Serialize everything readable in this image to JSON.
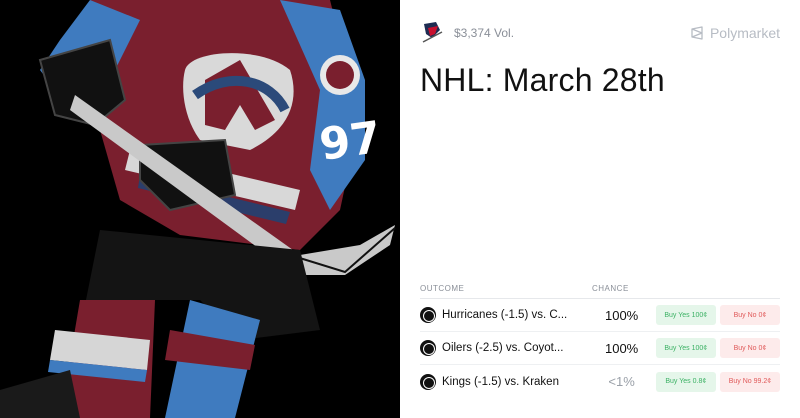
{
  "header": {
    "volume": "$3,374 Vol.",
    "brand": "Polymarket"
  },
  "market": {
    "title": "NHL: March 28th"
  },
  "table": {
    "col_outcome": "OUTCOME",
    "col_chance": "CHANCE",
    "rows": [
      {
        "outcome": "Hurricanes (-1.5) vs. C...",
        "chance": "100%",
        "buy_yes": "Buy Yes 100¢",
        "buy_no": "Buy No 0¢"
      },
      {
        "outcome": "Oilers (-2.5) vs. Coyot...",
        "chance": "100%",
        "buy_yes": "Buy Yes 100¢",
        "buy_no": "Buy No 0¢"
      },
      {
        "outcome": "Kings (-1.5) vs. Kraken",
        "chance": "<1%",
        "buy_yes": "Buy Yes 0.8¢",
        "buy_no": "Buy No 99.2¢"
      }
    ]
  },
  "colors": {
    "yes_bg": "#e5f6ea",
    "yes_text": "#3bb164",
    "no_bg": "#fdebeb",
    "no_text": "#e05a5a",
    "jersey_burgundy": "#7a1f2e",
    "jersey_blue": "#3f7bbf"
  },
  "icons": {
    "brand": "polymarket-logo-icon",
    "team": "nhl-team-logo-icon"
  }
}
